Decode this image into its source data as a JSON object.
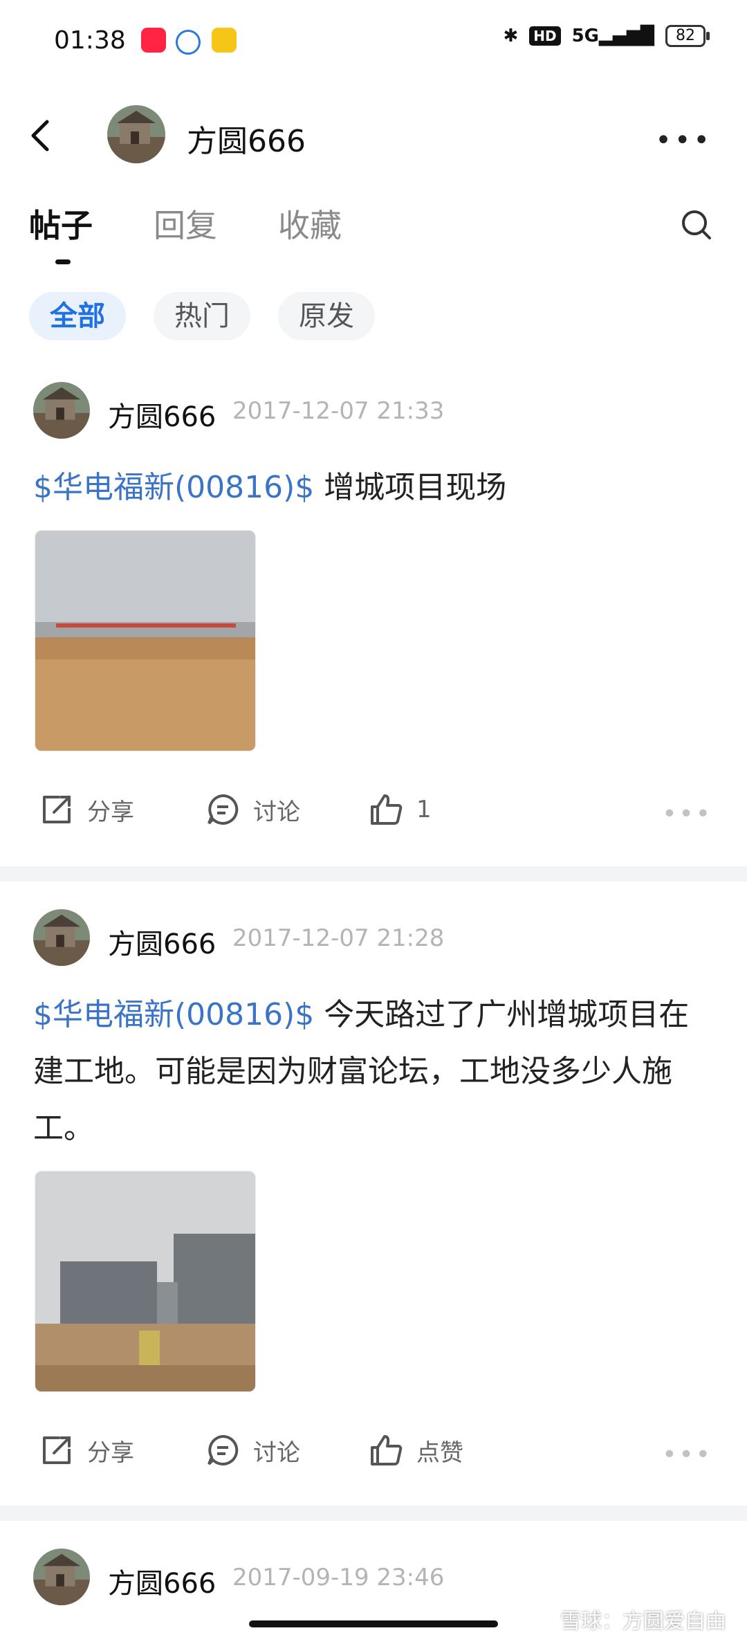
{
  "status_bar": {
    "time": "01:38",
    "hd": "HD",
    "network": "5G",
    "battery": "82"
  },
  "header": {
    "title": "方圆666",
    "back_icon": "chevron-left-icon",
    "more_icon": "more-horizontal-icon",
    "more_label": "•••"
  },
  "tabs": [
    {
      "label": "帖子",
      "active": true
    },
    {
      "label": "回复",
      "active": false
    },
    {
      "label": "收藏",
      "active": false
    }
  ],
  "filters": [
    {
      "label": "全部",
      "active": true
    },
    {
      "label": "热门",
      "active": false
    },
    {
      "label": "原发",
      "active": false
    }
  ],
  "posts": [
    {
      "author": "方圆666",
      "time": "2017-12-07 21:33",
      "stock": "$华电福新(00816)$",
      "text": " 增城项目现场",
      "share": "分享",
      "discuss": "讨论",
      "like": "1"
    },
    {
      "author": "方圆666",
      "time": "2017-12-07 21:28",
      "stock": "$华电福新(00816)$",
      "text": " 今天路过了广州增城项目在建工地。可能是因为财富论坛，工地没多少人施工。",
      "share": "分享",
      "discuss": "讨论",
      "like": "点赞"
    },
    {
      "author": "方圆666",
      "time": "2017-09-19 23:46"
    }
  ],
  "watermark": "雪球：方圆爱自由",
  "colors": {
    "accent": "#1f6fe5",
    "stock_link": "#3b74c7",
    "muted": "#b4b4b4"
  }
}
